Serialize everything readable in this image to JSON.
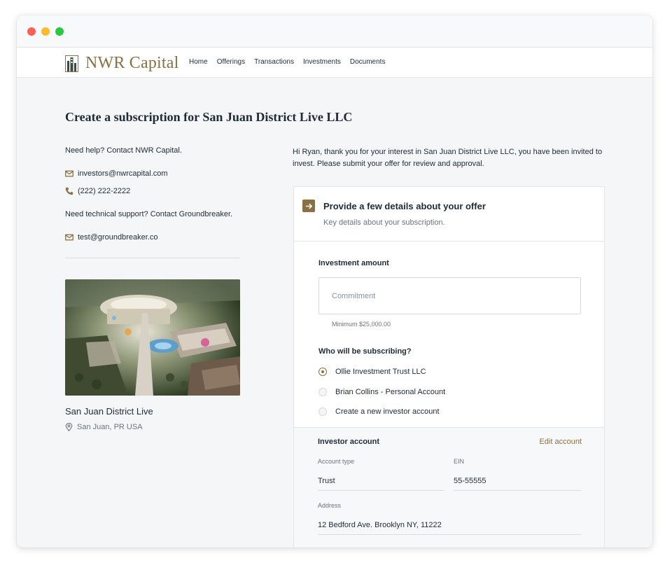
{
  "brand": {
    "name": "NWR Capital",
    "accent": "#8a7042"
  },
  "nav": {
    "items": [
      "Home",
      "Offerings",
      "Transactions",
      "Investments",
      "Documents"
    ]
  },
  "page": {
    "title": "Create a subscription for San Juan District Live LLC"
  },
  "sidebar": {
    "help_text": "Need help? Contact NWR Capital.",
    "email": "investors@nwrcapital.com",
    "phone": "(222) 222-2222",
    "tech_text": "Need technical support? Contact Groundbreaker.",
    "tech_email": "test@groundbreaker.co",
    "property_name": "San Juan District Live",
    "property_location": "San Juan, PR USA"
  },
  "intro": "Hi Ryan, thank you for your interest in San Juan District Live LLC, you have been invited to invest.  Please submit your offer for review and approval.",
  "form": {
    "title": "Provide a few details about your offer",
    "subtitle": "Key details about your subscription.",
    "amount_label": "Investment amount",
    "commitment_value": "",
    "commitment_placeholder": "Commitment",
    "minimum": "Minimum $25,000.00",
    "subscriber_label": "Who will be subscribing?",
    "subscriber_options": [
      {
        "label": "Ollie Investment Trust LLC",
        "selected": true
      },
      {
        "label": "Brian Collins - Personal Account",
        "selected": false
      },
      {
        "label": "Create a new investor account",
        "selected": false
      }
    ]
  },
  "account": {
    "title": "Investor account",
    "edit_label": "Edit account",
    "type_label": "Account type",
    "type_value": "Trust",
    "ein_label": "EIN",
    "ein_value": "55-55555",
    "address_label": "Address",
    "address_value": "12 Bedford Ave. Brooklyn NY, 11222"
  }
}
